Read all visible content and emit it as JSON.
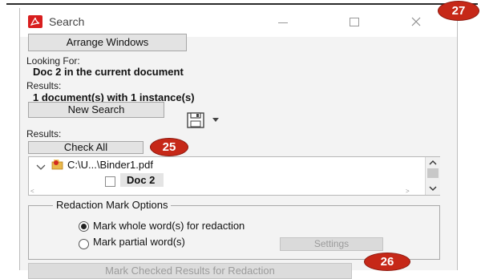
{
  "window": {
    "title": "Search"
  },
  "toolbar": {
    "arrange_label": "Arrange Windows",
    "new_search_label": "New Search",
    "check_all_label": "Check All"
  },
  "query": {
    "looking_for_label": "Looking For:",
    "looking_for_value": "Doc 2 in the current document",
    "results_label": "Results:",
    "results_value": "1 document(s) with 1 instance(s)",
    "results_label2": "Results:"
  },
  "tree": {
    "file": "C:\\U...\\Binder1.pdf",
    "item": "Doc 2"
  },
  "options": {
    "legend": "Redaction Mark Options",
    "whole_label": "Mark whole word(s) for redaction",
    "partial_label": "Mark partial word(s)",
    "settings_label": "Settings",
    "selected": "whole"
  },
  "footer": {
    "mark_label": "Mark Checked Results for Redaction"
  },
  "badges": {
    "b25": "25",
    "b26": "26",
    "b27": "27"
  },
  "colors": {
    "badge": "#c62818",
    "adobe_icon": "#d81e1e"
  },
  "icons": [
    "adobe-acrobat-icon",
    "minimize-icon",
    "maximize-icon",
    "close-icon",
    "save-icon",
    "dropdown-arrow-icon",
    "tree-collapse-icon",
    "pdf-file-icon",
    "checkbox-icon"
  ]
}
